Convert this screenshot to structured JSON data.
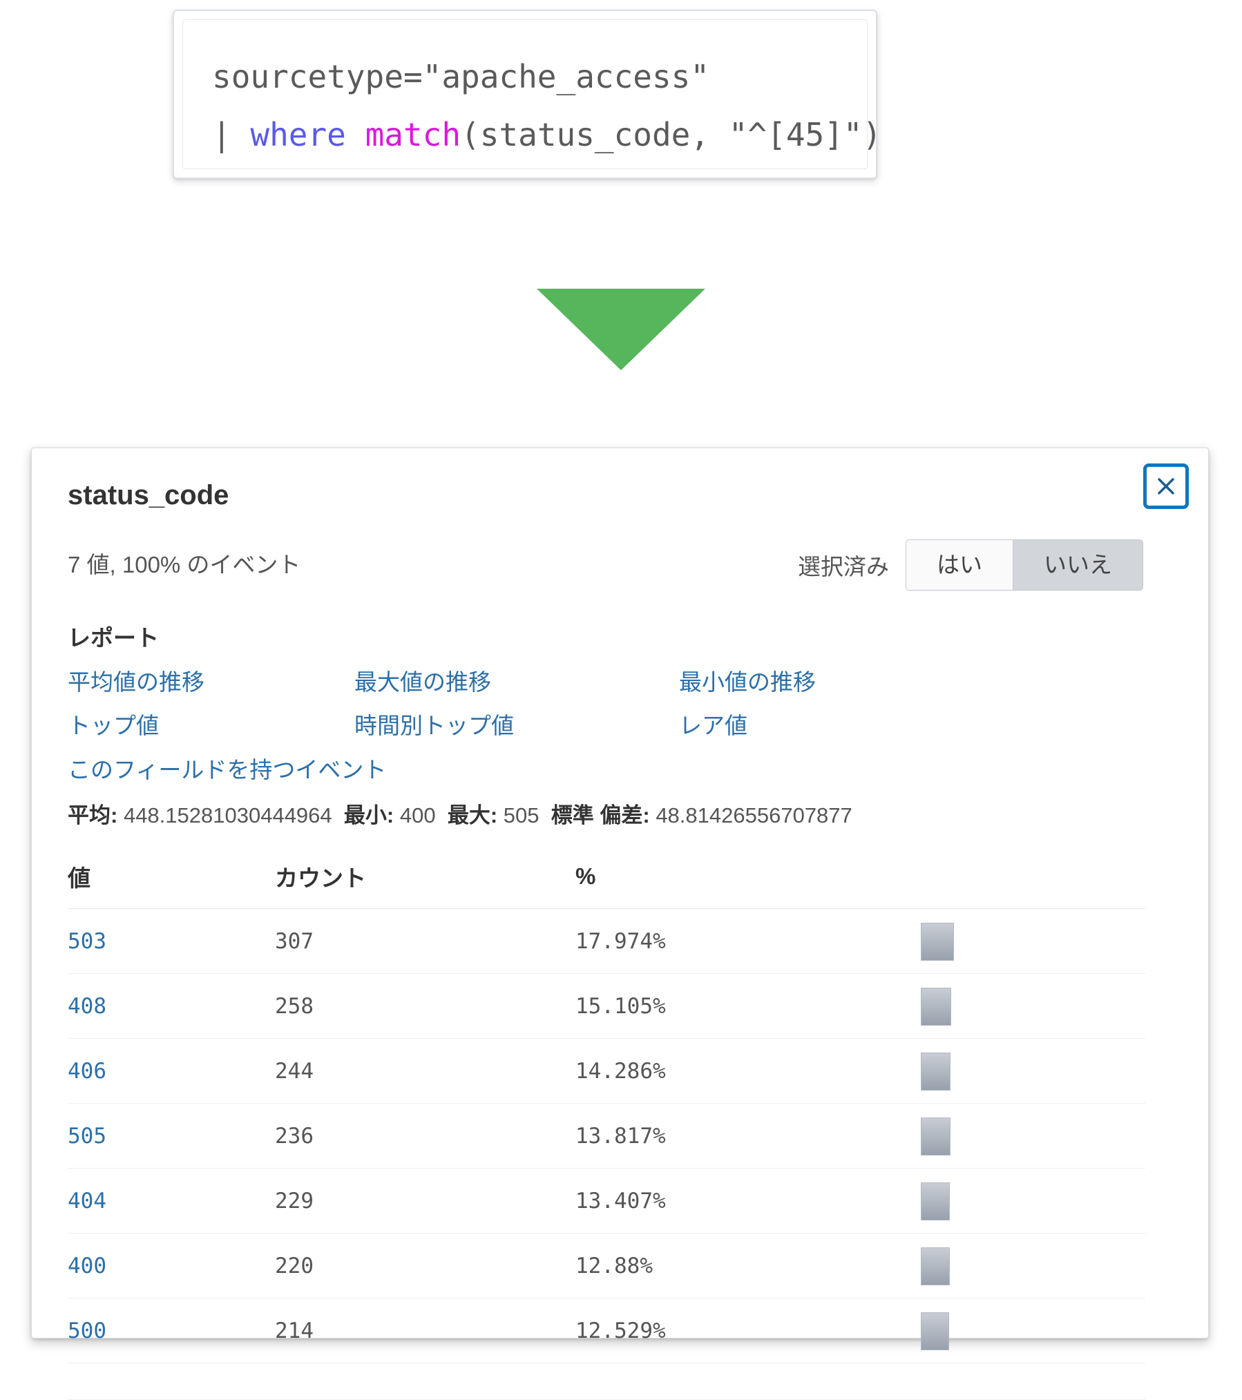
{
  "query": {
    "line1": "sourcetype=\"apache_access\"",
    "line2_pipe": "| ",
    "line2_where": "where ",
    "line2_func": "match",
    "line2_rest": "(status_code, \"^[45]\")"
  },
  "arrow": {
    "color": "#55b65b",
    "name": "down-arrow"
  },
  "panel": {
    "title": "status_code",
    "close_label": "×",
    "meta_count": "7 値, 100% のイベント",
    "selected_label": "選択済み",
    "toggle": {
      "yes": "はい",
      "no": "いいえ",
      "active": "no"
    },
    "reports_heading": "レポート",
    "report_links": [
      "平均値の推移",
      "最大値の推移",
      "最小値の推移",
      "トップ値",
      "時間別トップ値",
      "レア値"
    ],
    "field_events_link": "このフィールドを持つイベント",
    "stats": {
      "mean_label": "平均:",
      "mean_value": "448.15281030444964",
      "min_label": "最小:",
      "min_value": "400",
      "max_label": "最大:",
      "max_value": "505",
      "std_label": "標準 偏差:",
      "std_value": "48.81426556707877"
    },
    "table": {
      "headers": [
        "値",
        "カウント",
        "%",
        ""
      ],
      "rows": [
        {
          "value": "503",
          "count": "307",
          "pct": "17.974%",
          "bar_pct": 17.974
        },
        {
          "value": "408",
          "count": "258",
          "pct": "15.105%",
          "bar_pct": 15.105
        },
        {
          "value": "406",
          "count": "244",
          "pct": "14.286%",
          "bar_pct": 14.286
        },
        {
          "value": "505",
          "count": "236",
          "pct": "13.817%",
          "bar_pct": 13.817
        },
        {
          "value": "404",
          "count": "229",
          "pct": "13.407%",
          "bar_pct": 13.407
        },
        {
          "value": "400",
          "count": "220",
          "pct": "12.88%",
          "bar_pct": 12.88
        },
        {
          "value": "500",
          "count": "214",
          "pct": "12.529%",
          "bar_pct": 12.529
        }
      ]
    }
  },
  "chart_data": {
    "type": "bar",
    "title": "status_code value distribution",
    "categories": [
      "503",
      "408",
      "406",
      "505",
      "404",
      "400",
      "500"
    ],
    "values": [
      307,
      258,
      244,
      236,
      229,
      220,
      214
    ],
    "percentages": [
      17.974,
      15.105,
      14.286,
      13.817,
      13.407,
      12.88,
      12.529
    ],
    "xlabel": "値",
    "ylabel": "カウント",
    "legend": [],
    "grid": false
  }
}
